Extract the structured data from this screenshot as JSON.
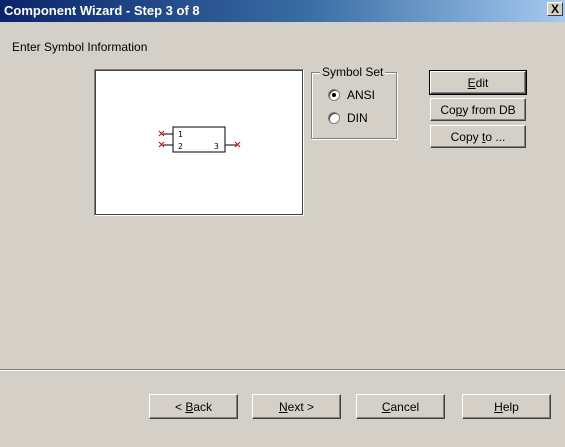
{
  "window": {
    "title": "Component Wizard - Step 3 of 8",
    "close_label": "X"
  },
  "main": {
    "heading": "Enter Symbol Information"
  },
  "symbol_preview": {
    "pin_labels": [
      "1",
      "2",
      "3"
    ]
  },
  "symbol_set": {
    "legend": "Symbol Set",
    "options": [
      {
        "label": "ANSI",
        "checked": true
      },
      {
        "label": "DIN",
        "checked": false
      }
    ]
  },
  "actions": {
    "edit": {
      "pre": "",
      "mn": "E",
      "post": "dit"
    },
    "copy_from_db": {
      "pre": "Co",
      "mn": "p",
      "post": "y from DB"
    },
    "copy_to": {
      "pre": "Copy ",
      "mn": "t",
      "post": "o ..."
    }
  },
  "footer": {
    "back": {
      "pre": "< ",
      "mn": "B",
      "post": "ack"
    },
    "next": {
      "pre": "",
      "mn": "N",
      "post": "ext >"
    },
    "cancel": {
      "pre": "",
      "mn": "C",
      "post": "ancel"
    },
    "help": {
      "pre": "",
      "mn": "H",
      "post": "elp"
    }
  },
  "colors": {
    "title_bar": "#0a246a",
    "face": "#d4d0c8",
    "pin_marker": "#cc0000"
  }
}
